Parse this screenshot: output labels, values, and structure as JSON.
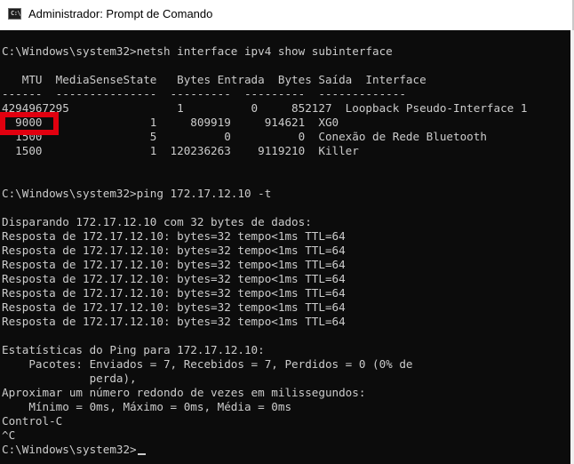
{
  "window": {
    "icon_text": "C:\\",
    "title": "Administrador: Prompt de Comando"
  },
  "console": {
    "lines": [
      "",
      "C:\\Windows\\system32>netsh interface ipv4 show subinterface",
      "",
      "   MTU  MediaSenseState   Bytes Entrada  Bytes Saída  Interface",
      "------  ---------------  ---------  ---------  -------------",
      "4294967295                1          0     852127  Loopback Pseudo-Interface 1",
      "  9000                1     809919     914621  XG0",
      "  1500                5          0          0  Conexão de Rede Bluetooth",
      "  1500                1  120236263    9119210  Killer",
      "",
      "",
      "C:\\Windows\\system32>ping 172.17.12.10 -t",
      "",
      "Disparando 172.17.12.10 com 32 bytes de dados:",
      "Resposta de 172.17.12.10: bytes=32 tempo<1ms TTL=64",
      "Resposta de 172.17.12.10: bytes=32 tempo<1ms TTL=64",
      "Resposta de 172.17.12.10: bytes=32 tempo<1ms TTL=64",
      "Resposta de 172.17.12.10: bytes=32 tempo<1ms TTL=64",
      "Resposta de 172.17.12.10: bytes=32 tempo<1ms TTL=64",
      "Resposta de 172.17.12.10: bytes=32 tempo<1ms TTL=64",
      "Resposta de 172.17.12.10: bytes=32 tempo<1ms TTL=64",
      "",
      "Estatísticas do Ping para 172.17.12.10:",
      "    Pacotes: Enviados = 7, Recebidos = 7, Perdidos = 0 (0% de",
      "             perda),",
      "Aproximar um número redondo de vezes em milissegundos:",
      "    Mínimo = 0ms, Máximo = 0ms, Média = 0ms",
      "Control-C",
      "^C",
      "C:\\Windows\\system32>"
    ]
  },
  "annotation": {
    "highlighted_value": "9000",
    "color": "#e1000f"
  },
  "colors": {
    "console_background": "#0c0c0c",
    "console_text": "#cccccc",
    "titlebar_background": "#ffffff"
  }
}
